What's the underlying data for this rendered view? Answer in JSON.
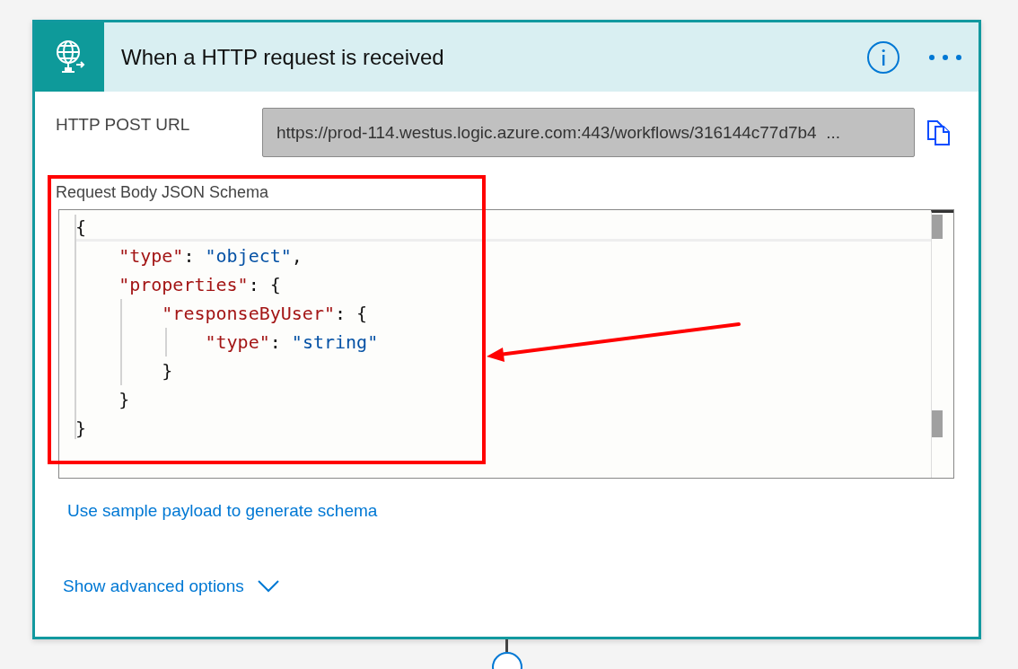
{
  "card": {
    "title": "When a HTTP request is received",
    "url_field": {
      "label": "HTTP POST URL",
      "value": "https://prod-114.westus.logic.azure.com:443/workflows/316144c77d7b4  ..."
    },
    "schema": {
      "label": "Request Body JSON Schema",
      "lines": [
        [
          {
            "kind": "punct",
            "text": "{"
          }
        ],
        [
          {
            "kind": "key",
            "text": "    \"type\""
          },
          {
            "kind": "punct",
            "text": ": "
          },
          {
            "kind": "string",
            "text": "\"object\""
          },
          {
            "kind": "punct",
            "text": ","
          }
        ],
        [
          {
            "kind": "key",
            "text": "    \"properties\""
          },
          {
            "kind": "punct",
            "text": ": {"
          }
        ],
        [
          {
            "kind": "key",
            "text": "        \"responseByUser\""
          },
          {
            "kind": "punct",
            "text": ": {"
          }
        ],
        [
          {
            "kind": "key",
            "text": "            \"type\""
          },
          {
            "kind": "punct",
            "text": ": "
          },
          {
            "kind": "string",
            "text": "\"string\""
          }
        ],
        [
          {
            "kind": "punct",
            "text": "        }"
          }
        ],
        [
          {
            "kind": "punct",
            "text": "    }"
          }
        ],
        [
          {
            "kind": "punct",
            "text": "}"
          }
        ]
      ]
    },
    "sample_link": "Use sample payload to generate schema",
    "advanced_link": "Show advanced options"
  },
  "annotation": {
    "kind": "box-with-arrow"
  }
}
